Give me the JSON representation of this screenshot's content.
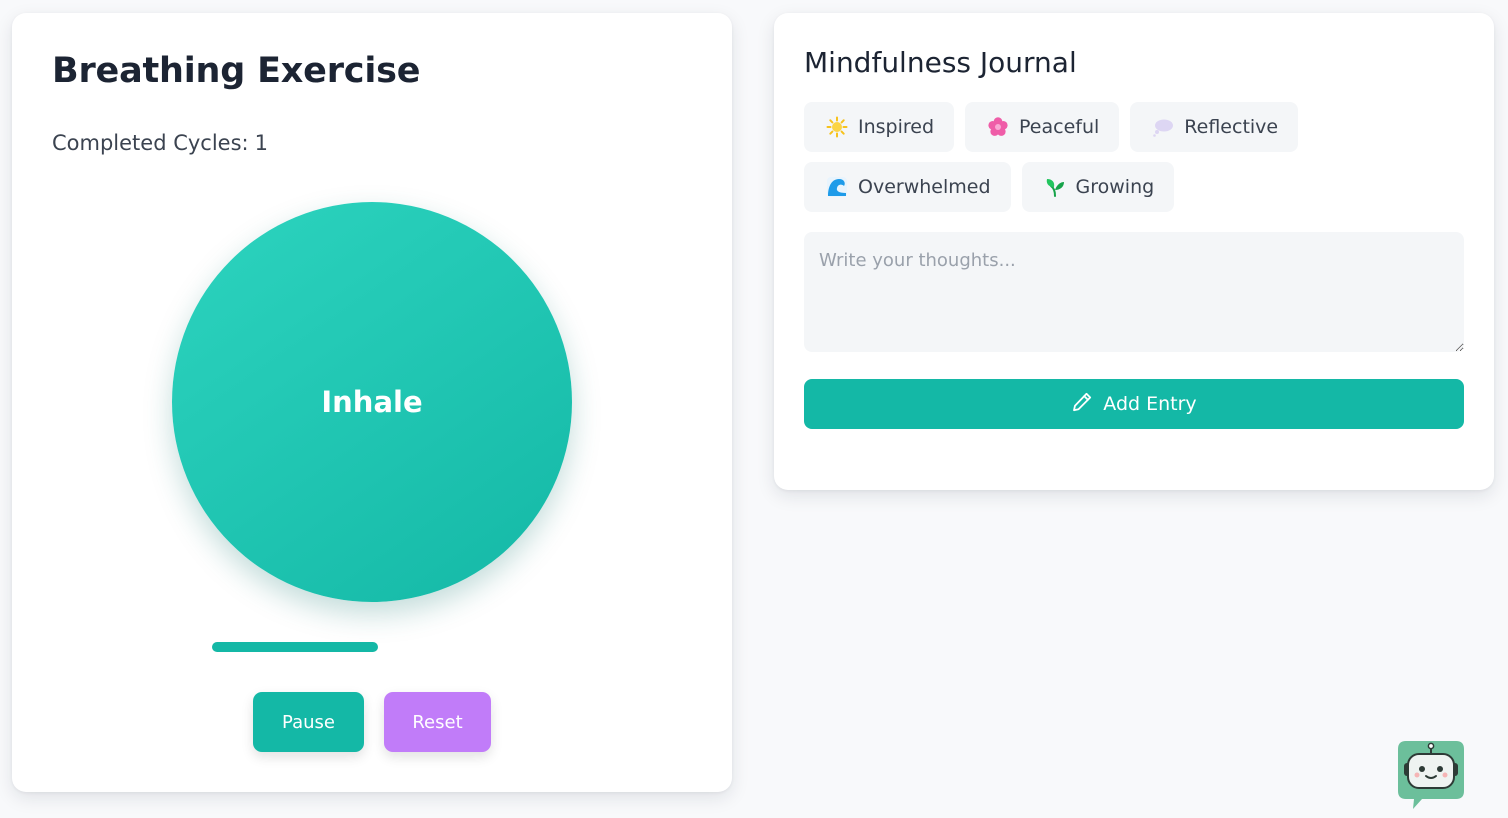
{
  "breathing": {
    "title": "Breathing Exercise",
    "cycles_label": "Completed Cycles:",
    "cycles_count": "1",
    "phase": "Inhale",
    "progress": 0.52,
    "pause_label": "Pause",
    "reset_label": "Reset"
  },
  "journal": {
    "title": "Mindfulness Journal",
    "moods": [
      {
        "label": "Inspired",
        "icon": "sun-icon"
      },
      {
        "label": "Peaceful",
        "icon": "flower-icon"
      },
      {
        "label": "Reflective",
        "icon": "thought-bubble-icon"
      },
      {
        "label": "Overwhelmed",
        "icon": "wave-icon"
      },
      {
        "label": "Growing",
        "icon": "seedling-icon"
      }
    ],
    "textarea_placeholder": "Write your thoughts...",
    "add_entry_label": "Add Entry"
  },
  "colors": {
    "accent": "#14b8a6",
    "reset": "#c17cf9",
    "bot": "#6cbf9b"
  }
}
